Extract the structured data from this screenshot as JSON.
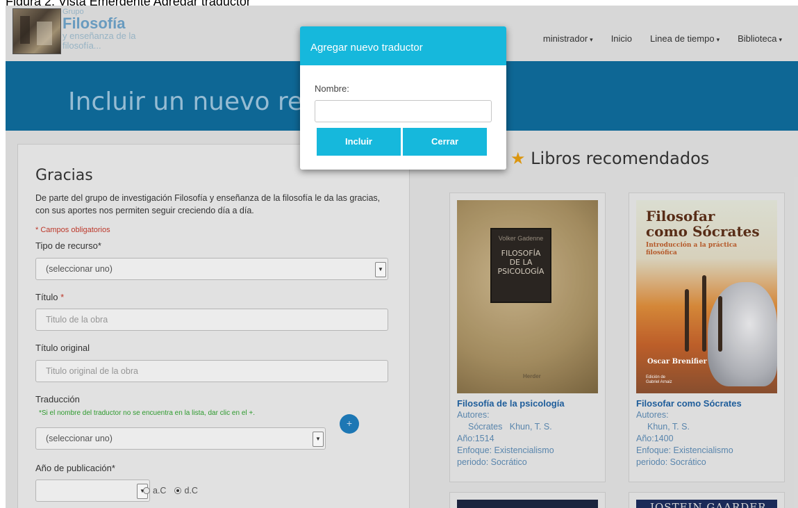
{
  "caption": "Figura 2. Vista Emergente Agregar traductor",
  "header": {
    "logo": {
      "small": "Grupo",
      "big": "Filosofía",
      "sub1": "y enseñanza de la",
      "sub2": "filosofía..."
    },
    "nav": [
      {
        "label": "ministrador",
        "caret": true
      },
      {
        "label": "Inicio",
        "caret": false
      },
      {
        "label": "Linea de tiempo",
        "caret": true
      },
      {
        "label": "Biblioteca",
        "caret": true
      }
    ]
  },
  "banner": {
    "title": "Incluir un nuevo recur"
  },
  "form": {
    "title": "Gracias",
    "description": "De parte del grupo de investigación Filosofía y enseñanza de la filosofía le da las gracias, con sus aportes nos permiten seguir creciendo día a día.",
    "required_note": "* Campos obligatorios",
    "tipo_label": "Tipo de recurso*",
    "tipo_value": "(seleccionar uno)",
    "titulo_label": "Título",
    "titulo_placeholder": "Titulo de la obra",
    "titulo_orig_label": "Título original",
    "titulo_orig_placeholder": "Titulo original de la obra",
    "traduccion_label": "Traducción",
    "traduccion_hint": "*Si el nombre del traductor no se encuentra en la lista, dar clic en el +.",
    "traduccion_value": "(seleccionar uno)",
    "plus": "+",
    "anio_label": "Año de publicación*",
    "anio_value": "",
    "radio_ac": "a.C",
    "radio_dc": "d.C"
  },
  "recommended": {
    "title": "Libros recomendados",
    "books": [
      {
        "cover_author": "Volker Gadenne",
        "cover_title_1": "FILOSOFÍA",
        "cover_title_2": "DE LA",
        "cover_title_3": "PSICOLOGÍA",
        "cover_publisher": "Herder",
        "title": "Filosofía de la psicología",
        "authors_label": "Autores:",
        "authors": "Sócrates   Khun, T. S.",
        "year": "Año:1514",
        "focus": "Enfoque: Existencialismo",
        "period": "periodo: Socrático"
      },
      {
        "cover_title_1": "Filosofar",
        "cover_title_2": "como Sócrates",
        "cover_sub_1": "Introducción a la práctica",
        "cover_sub_2": "filosófica",
        "cover_author": "Oscar Brenifier",
        "cover_note_1": "Edición de",
        "cover_note_2": "Gabriel Arnaiz",
        "title": "Filosofar como Sócrates",
        "authors_label": "Autores:",
        "authors": "Khun, T. S.",
        "year": "Año:1400",
        "focus": "Enfoque: Existencialismo",
        "period": "periodo: Socrático"
      }
    ],
    "third_cover_text": "JOSTEIN GAARDER"
  },
  "modal": {
    "title": "Agregar nuevo traductor",
    "name_label": "Nombre:",
    "name_value": "",
    "include_button": "Incluir",
    "close_button": "Cerrar"
  }
}
